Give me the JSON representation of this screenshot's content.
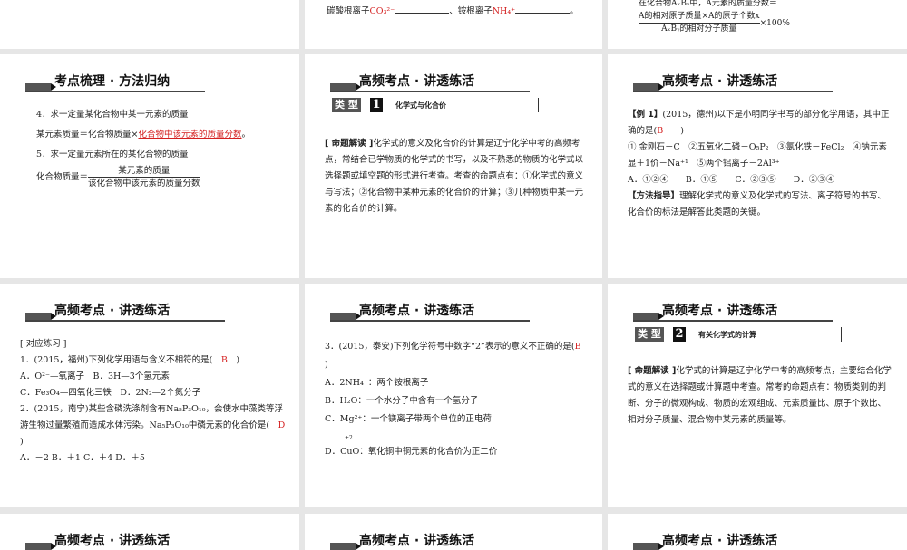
{
  "slides": {
    "s0": {},
    "s1": {
      "line1": "碳酸根离子",
      "co3": "CO₃²⁻",
      "sep": "、铵根离子",
      "nh4": "NH₄⁺",
      "end": "。"
    },
    "s2": {
      "line1": "在化合物AₓBᵧ中，A元素的质量分数＝",
      "num": "A的相对原子质量×A的原子个数x",
      "den": "AₓBᵧ的相对分子质量",
      "mult": "×100%"
    },
    "s3": {
      "header": "考点梳理 · 方法归纳",
      "p1": "4．求一定量某化合物中某一元素的质量",
      "p2a": "某元素质量＝化合物质量×",
      "p2ans": "化合物中该元素的质量分数",
      "p2end": "。",
      "p3": "5．求一定量元素所在的某化合物的质量",
      "p4a": "化合物质量＝",
      "p4num": "某元素的质量",
      "p4den": "该化合物中该元素的质量分数"
    },
    "s4": {
      "header": "高频考点 · 讲透练活",
      "type_label": "类 型",
      "type_num": "1",
      "type_title": "化学式与化合价",
      "tag": "[ 命题解读 ]",
      "text": "化学式的意义及化合价的计算是辽宁化学中考的高频考点，常结合已学物质的化学式的书写，以及不熟悉的物质的化学式以选择题或填空题的形式进行考查。考查的命题点有：①化学式的意义与写法；②化合物中某种元素的化合价的计算；③几种物质中某一元素的化合价的计算。"
    },
    "s5": {
      "header": "高频考点 · 讲透练活",
      "ex": "【例 1】",
      "q": "(2015，德州)以下是小明同学书写的部分化学用语，其中正确的是(",
      "ans": "B",
      "qend": ")",
      "items": "① 金刚石－C　②五氧化二磷－O₅P₂　③氯化铁－FeCl₂　④钠元素显＋1价－Na⁺¹　⑤两个铝离子－2Al³⁺",
      "opts": "A．①②④　　B．①⑤　　C．②③⑤　　D．②③④",
      "guide_tag": "【方法指导】",
      "guide": "理解化学式的意义及化学式的写法、离子符号的书写、化合价的标法是解答此类题的关键。"
    },
    "s6": {
      "header": "高频考点 · 讲透练活",
      "tag": "[ 对应练习 ]",
      "q1": "1．(2015，福州)下列化学用语与含义不相符的是(",
      "q1ans": "B",
      "q1end": ")",
      "q1a": "A．O²⁻—氧离子　B．3H—3个氢元素",
      "q1b": "C．Fe₃O₄—四氧化三铁　D．2N₂—2个氮分子",
      "q2": "2．(2015，南宁)某些含磷洗涤剂含有Na₅P₃O₁₀，会使水中藻类等浮游生物过量繁殖而造成水体污染。Na₅P₃O₁₀中磷元素的化合价是(",
      "q2ans": "D",
      "q2end": ")",
      "q2opts": "A．－2 B．＋1 C．＋4 D．＋5"
    },
    "s7": {
      "header": "高频考点 · 讲透练活",
      "q3": "3．(2015，泰安)下列化学符号中数字“2”表示的意义不正确的是(",
      "ans": "B",
      "qend": ")",
      "a": "A．2NH₄⁺：两个铵根离子",
      "b": "B．H₂O：一个水分子中含有一个氢分子",
      "c": "C．Mg²⁺：一个镁离子带两个单位的正电荷",
      "d_sup": "+2",
      "d": "D．CuO：氧化铜中铜元素的化合价为正二价"
    },
    "s8": {
      "header": "高频考点 · 讲透练活",
      "type_label": "类 型",
      "type_num": "2",
      "type_title": "有关化学式的计算",
      "tag": "[ 命题解读 ]",
      "text": "化学式的计算是辽宁化学中考的高频考点，主要结合化学式的意义在选择题或计算题中考查。常考的命题点有：物质类别的判断、分子的微观构成、物质的宏观组成、元素质量比、原子个数比、相对分子质量、混合物中某元素的质量等。"
    },
    "s9": {
      "header": "高频考点 · 讲透练活"
    },
    "s10": {
      "header": "高频考点 · 讲透练活"
    },
    "s11": {
      "header": "高频考点 · 讲透练活"
    }
  }
}
